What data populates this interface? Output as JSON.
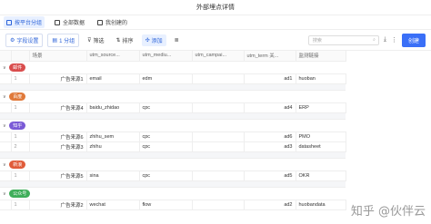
{
  "window": {
    "title": "外部埋点详情"
  },
  "view_tabs": [
    {
      "label": "按平台分组",
      "active": true
    },
    {
      "label": "全部数据",
      "active": false
    },
    {
      "label": "我创建的",
      "active": false
    }
  ],
  "toolbar": {
    "field_settings": "字段设置",
    "group": "1 分组",
    "filter": "筛选",
    "sort": "排序",
    "add": "添加",
    "search_placeholder": "搜索",
    "create_label": "创建"
  },
  "table": {
    "columns": [
      "场景",
      "utm_source...",
      "utm_mediu...",
      "utm_campai...",
      "utm_term 关...",
      "监测链接"
    ],
    "groups": [
      {
        "tag": "邮件",
        "color": "#d94d4d",
        "rows": [
          {
            "num": "1",
            "scene": "广告来源1",
            "source": "email",
            "medium": "edm",
            "campaign": "",
            "term": "ad1",
            "link": "huoban"
          }
        ]
      },
      {
        "tag": "百度",
        "color": "#e0793a",
        "rows": [
          {
            "num": "1",
            "scene": "广告来源4",
            "source": "baidu_zhidao",
            "medium": "cpc",
            "campaign": "",
            "term": "ad4",
            "link": "ERP"
          }
        ]
      },
      {
        "tag": "知乎",
        "color": "#7a5ad6",
        "rows": [
          {
            "num": "1",
            "scene": "广告来源6",
            "source": "zhihu_sem",
            "medium": "cpc",
            "campaign": "",
            "term": "ad6",
            "link": "PMO"
          },
          {
            "num": "2",
            "scene": "广告来源3",
            "source": "zhihu",
            "medium": "cpc",
            "campaign": "",
            "term": "ad3",
            "link": "datasheet"
          }
        ]
      },
      {
        "tag": "新浪",
        "color": "#e05c3a",
        "rows": [
          {
            "num": "1",
            "scene": "广告来源5",
            "source": "sina",
            "medium": "cpc",
            "campaign": "",
            "term": "ad5",
            "link": "OKR"
          }
        ]
      },
      {
        "tag": "公众号",
        "color": "#3fae5a",
        "rows": [
          {
            "num": "1",
            "scene": "广告来源2",
            "source": "wechat",
            "medium": "flow",
            "campaign": "",
            "term": "ad2",
            "link": "huobandata"
          }
        ]
      }
    ]
  },
  "watermark": "知乎 @伙伴云"
}
